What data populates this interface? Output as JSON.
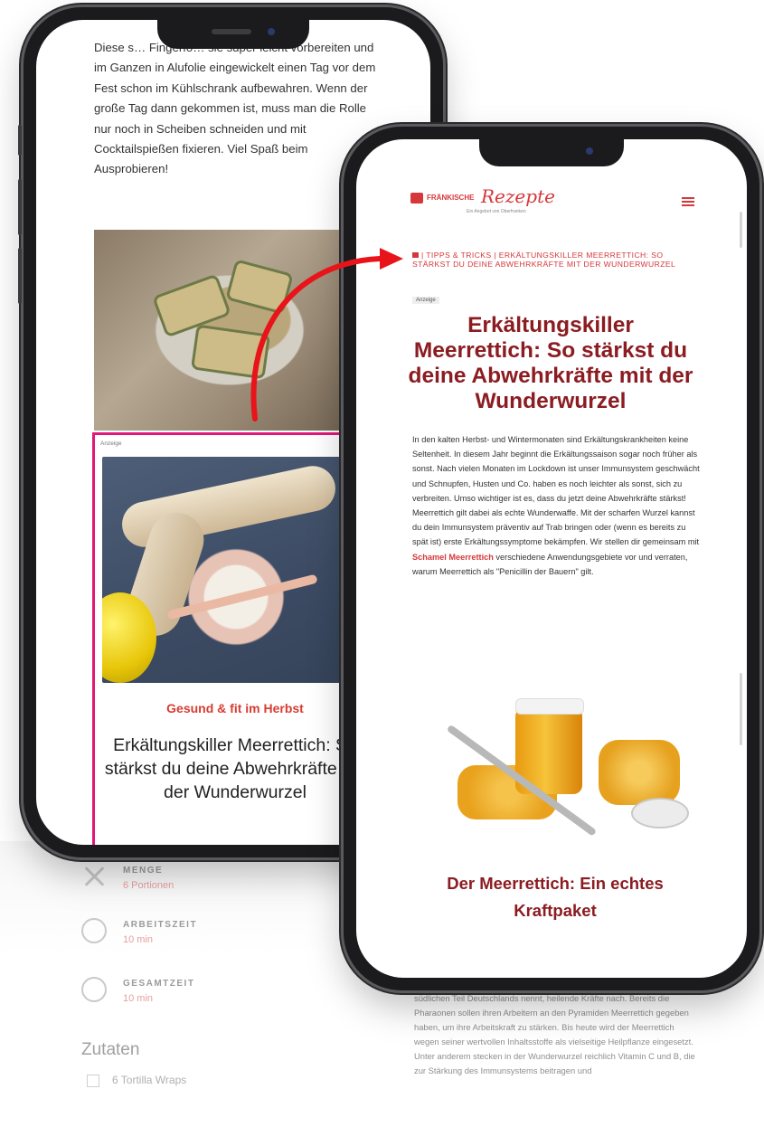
{
  "background_page": {
    "meta": [
      {
        "label": "MENGE",
        "value": "6 Portionen",
        "icon": "cutlery-icon"
      },
      {
        "label": "ARBEITSZEIT",
        "value": "10 min",
        "icon": "clock-icon"
      },
      {
        "label": "GESAMTZEIT",
        "value": "10 min",
        "icon": "clock-icon"
      }
    ],
    "ingredients_heading": "Zutaten",
    "first_ingredient": "6 Tortilla Wraps",
    "right_text": "Schon seit Jahrhunderten sagt man dem „Kren“, wie man Meerrettich im südlichen Teil Deutschlands nennt, heilende Kräfte nach. Bereits die Pharaonen sollen ihren Arbeitern an den Pyramiden Meerrettich gegeben haben, um ihre Arbeitskraft zu stärken. Bis heute wird der Meerrettich wegen seiner wertvollen Inhaltsstoffe als vielseitige Heilpflanze eingesetzt. Unter anderem stecken in der Wunderwurzel reichlich Vitamin C und B, die zur Stärkung des Immunsystems beitragen und"
  },
  "left_phone": {
    "article_text": "Diese s… Fingerfo… sie super leicht vorbereiten und im Ganzen in Alufolie eingewickelt einen Tag vor dem Fest schon im Kühlschrank aufbewahren. Wenn der große Tag dann gekommen ist, muss man die Rolle nur noch in Scheiben schneiden und mit Cocktailspießen fixieren. Viel Spaß beim Ausprobieren!",
    "ad": {
      "label": "Anzeige",
      "kicker": "Gesund & fit im Herbst",
      "title": "Erkältungskiller Meerrettich: So stärkst du deine Abwehrkräfte mit der Wunderwurzel"
    }
  },
  "right_phone": {
    "logo": {
      "brand": "FRÄNKISCHE",
      "script": "Rezepte",
      "tagline": "Ein Angebot von Oberfranken"
    },
    "breadcrumb": "| TIPPS & TRICKS | ERKÄLTUNGSKILLER MEERRETTICH: SO STÄRKST DU DEINE ABWEHRKRÄFTE MIT DER WUNDERWURZEL",
    "badge": "Anzeige",
    "title": "Erkältungskiller Meerrettich: So stärkst du deine Abwehrkräfte mit der Wunderwurzel",
    "intro_part1": "In den kalten Herbst- und Wintermonaten sind Erkältungskrankheiten keine Seltenheit. In diesem Jahr beginnt die Erkältungssaison sogar noch früher als sonst. Nach vielen Monaten im Lockdown ist unser Immunsystem geschwächt und Schnupfen, Husten und Co. haben es noch leichter als sonst, sich zu verbreiten. Umso wichtiger ist es, dass du jetzt deine Abwehrkräfte stärkst! Meerrettich gilt dabei als echte Wunderwaffe. Mit der scharfen Wurzel kannst du dein Immunsystem präventiv auf Trab bringen oder (wenn es bereits zu spät ist) erste Erkältungssymptome bekämpfen. Wir stellen dir gemeinsam mit ",
    "intro_link": "Schamel Meerrettich",
    "intro_part2": " verschiedene Anwendungsgebiete vor und verraten, warum Meerrettich als \"Penicillin der Bauern\" gilt.",
    "subtitle": "Der Meerrettich: Ein echtes Kraftpaket"
  },
  "colors": {
    "brand_red": "#d6373a",
    "title_red": "#8b1c21",
    "ad_frame": "#e0187a",
    "arrow": "#e8141a"
  }
}
